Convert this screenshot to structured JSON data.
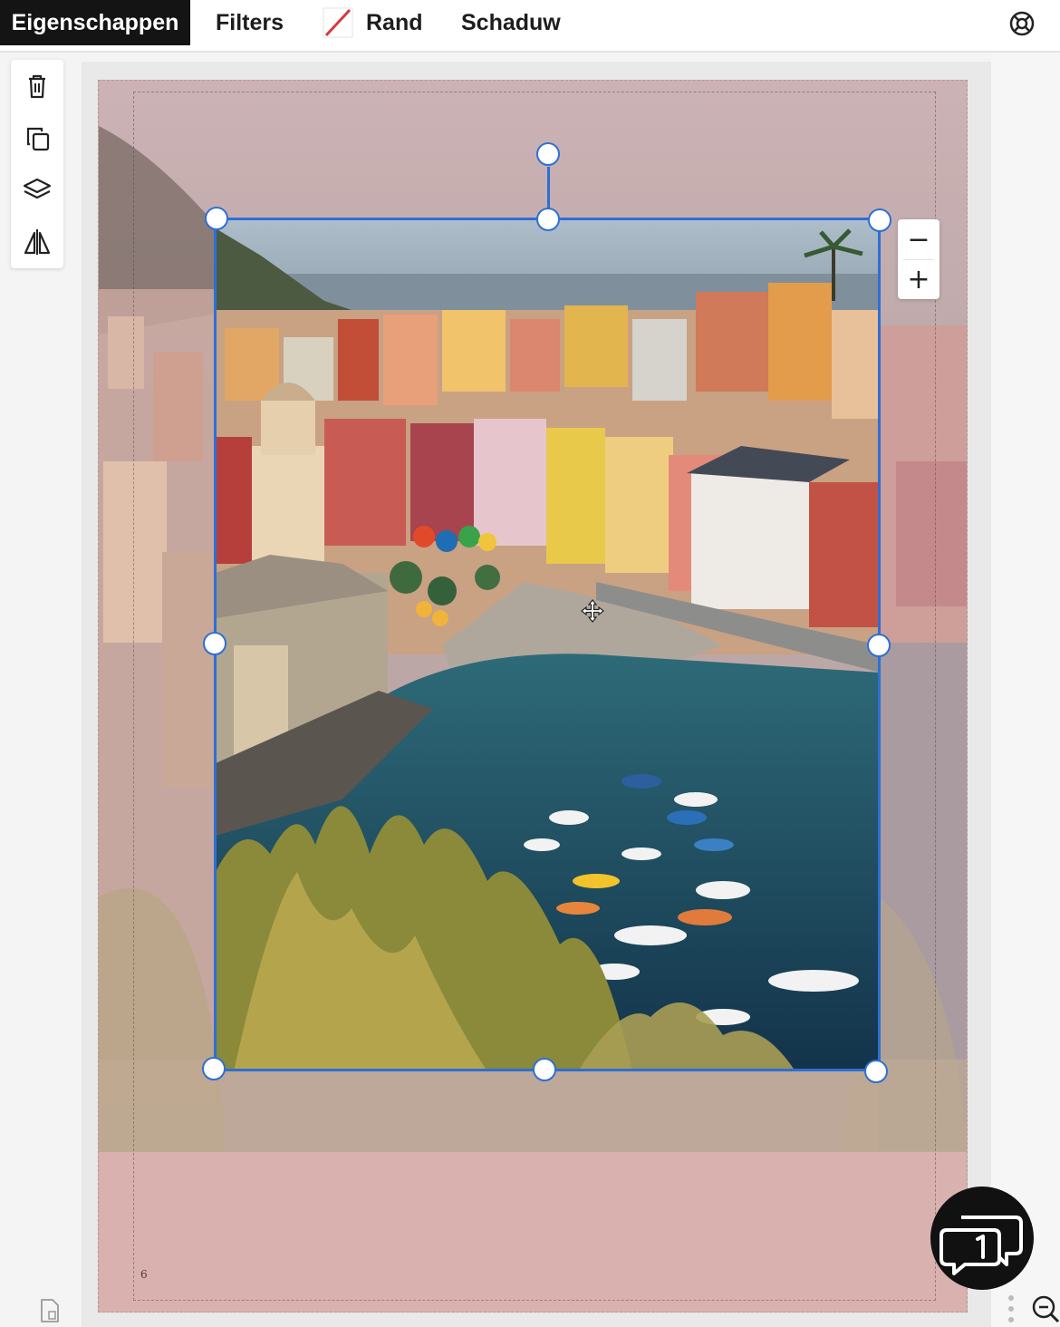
{
  "toolbar": {
    "tabs": [
      {
        "label": "Eigenschappen",
        "active": true
      },
      {
        "label": "Filters",
        "active": false
      },
      {
        "label": "Rand",
        "active": false
      },
      {
        "label": "Schaduw",
        "active": false
      }
    ],
    "rand_icon": "diagonal-slash-icon",
    "help_icon": "lifebuoy-icon"
  },
  "side_tools": [
    {
      "name": "delete",
      "icon": "trash-icon"
    },
    {
      "name": "duplicate",
      "icon": "copy-icon"
    },
    {
      "name": "layers",
      "icon": "layers-icon"
    },
    {
      "name": "flip",
      "icon": "flip-icon"
    }
  ],
  "zoom": {
    "minus_label": "−",
    "plus_label": "+"
  },
  "page": {
    "number": "6",
    "background_color": "#d9b1ae"
  },
  "selection": {
    "color": "#2d6fd6"
  },
  "chat": {
    "icon": "chat-bubbles-icon"
  }
}
